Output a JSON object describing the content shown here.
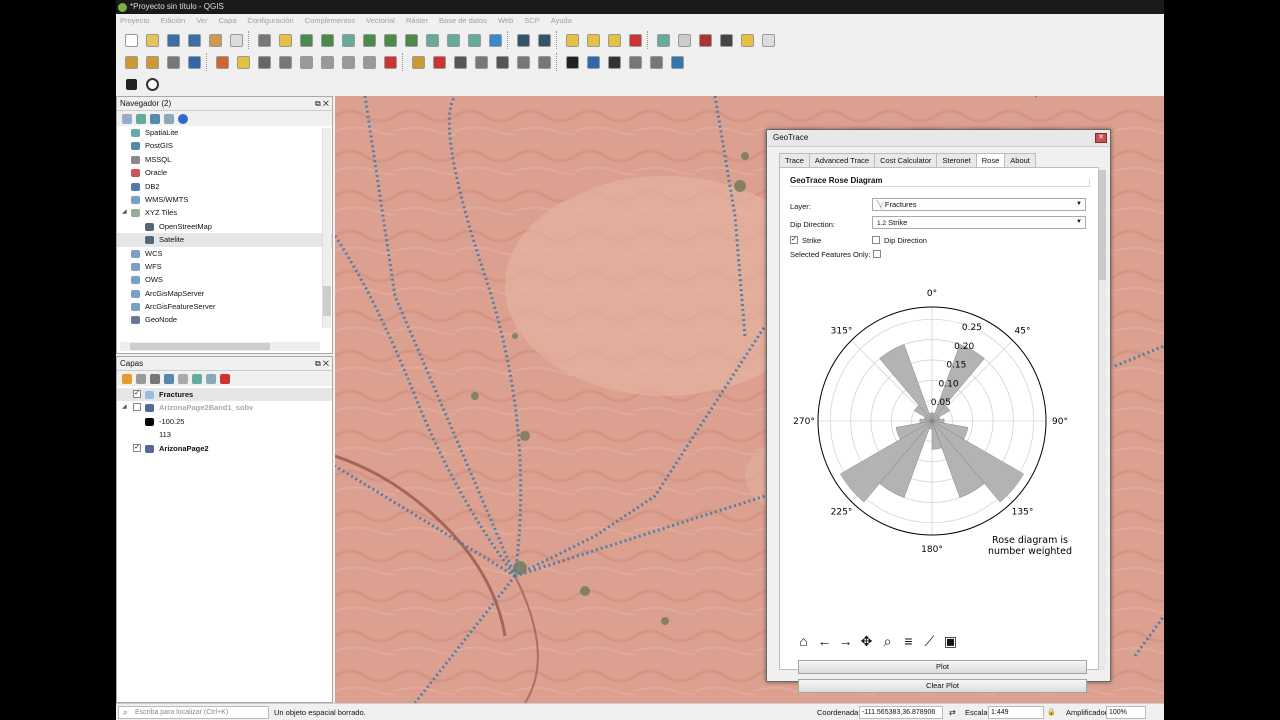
{
  "window": {
    "title": "*Proyecto sin título - QGIS"
  },
  "menu": [
    "Proyecto",
    "Edición",
    "Ver",
    "Capa",
    "Configuración",
    "Complementos",
    "Vectorial",
    "Ráster",
    "Base de datos",
    "Web",
    "SCP",
    "Ayuda"
  ],
  "navigator": {
    "title": "Navegador (2)",
    "items": [
      {
        "label": "SpatiaLite",
        "icon": "spatialite-icon"
      },
      {
        "label": "PostGIS",
        "icon": "postgis-icon"
      },
      {
        "label": "MSSQL",
        "icon": "mssql-icon"
      },
      {
        "label": "Oracle",
        "icon": "oracle-icon"
      },
      {
        "label": "DB2",
        "icon": "db2-icon"
      },
      {
        "label": "WMS/WMTS",
        "icon": "globe-icon"
      },
      {
        "label": "XYZ Tiles",
        "icon": "xyz-tiles-icon"
      },
      {
        "label": "OpenStreetMap",
        "icon": "tile-icon"
      },
      {
        "label": "Satelite",
        "icon": "tile-icon"
      },
      {
        "label": "WCS",
        "icon": "globe-icon"
      },
      {
        "label": "WFS",
        "icon": "globe-icon"
      },
      {
        "label": "OWS",
        "icon": "globe-icon"
      },
      {
        "label": "ArcGisMapServer",
        "icon": "globe-icon"
      },
      {
        "label": "ArcGisFeatureServer",
        "icon": "globe-icon"
      },
      {
        "label": "GeoNode",
        "icon": "geonode-icon"
      }
    ]
  },
  "layers": {
    "title": "Capas",
    "items": [
      {
        "label": "Fractures",
        "checked": true
      },
      {
        "label": "ArizonaPage2Band1_sobv",
        "checked": false
      },
      {
        "label": "-100.25"
      },
      {
        "label": "113"
      },
      {
        "label": "ArizonaPage2",
        "checked": true
      }
    ]
  },
  "status": {
    "locate_placeholder": "Escriba para localizar (Ctrl+K)",
    "message": "Un objeto espacial borrado.",
    "coord_label": "Coordenada",
    "coord_value": "-111.565383,36.878906",
    "scale_label": "Escala",
    "scale_value": "1:449",
    "magnifier_label": "Amplificador",
    "magnifier_value": "100%"
  },
  "dialog": {
    "title": "GeoTrace",
    "tabs": [
      "Trace",
      "Advanced Trace",
      "Cost Calculator",
      "Steronet",
      "Rose",
      "About"
    ],
    "active_tab": "Rose",
    "section_title": "GeoTrace Rose Diagram",
    "layer_label": "Layer:",
    "layer_value": "Fractures",
    "dip_label": "Dip Direction:",
    "dip_value": "Strike",
    "dip_prefix": "1.2",
    "strike_label": "Strike",
    "strike_checked": true,
    "dipdir_label": "Dip Direction",
    "dipdir_checked": false,
    "selected_label": "Selected Features Only:",
    "plot_button": "Plot",
    "clear_button": "Clear Plot"
  },
  "chart_data": {
    "type": "rose",
    "angle_labels": [
      "0°",
      "45°",
      "90°",
      "135°",
      "180°",
      "225°",
      "270°",
      "315°"
    ],
    "radial_ticks": [
      0.05,
      0.1,
      0.15,
      0.2,
      0.25
    ],
    "radial_tick_labels": [
      "0.05",
      "0.10",
      "0.15",
      "0.20",
      "0.25"
    ],
    "rmax": 0.28,
    "bin_width_deg": 20,
    "bins": [
      {
        "center": 10,
        "value": 0.02
      },
      {
        "center": 30,
        "value": 0.2
      },
      {
        "center": 50,
        "value": 0.05
      },
      {
        "center": 70,
        "value": 0.02
      },
      {
        "center": 90,
        "value": 0.03
      },
      {
        "center": 110,
        "value": 0.09
      },
      {
        "center": 130,
        "value": 0.26
      },
      {
        "center": 150,
        "value": 0.2
      },
      {
        "center": 170,
        "value": 0.07
      },
      {
        "center": 190,
        "value": 0.02
      },
      {
        "center": 210,
        "value": 0.2
      },
      {
        "center": 230,
        "value": 0.26
      },
      {
        "center": 250,
        "value": 0.09
      },
      {
        "center": 270,
        "value": 0.03
      },
      {
        "center": 290,
        "value": 0.02
      },
      {
        "center": 310,
        "value": 0.05
      },
      {
        "center": 330,
        "value": 0.2
      },
      {
        "center": 350,
        "value": 0.02
      }
    ],
    "annotation": [
      "Rose diagram is",
      "number weighted"
    ],
    "fill_color": "#b3b3b3",
    "edge_color": "#7a7a7a"
  }
}
